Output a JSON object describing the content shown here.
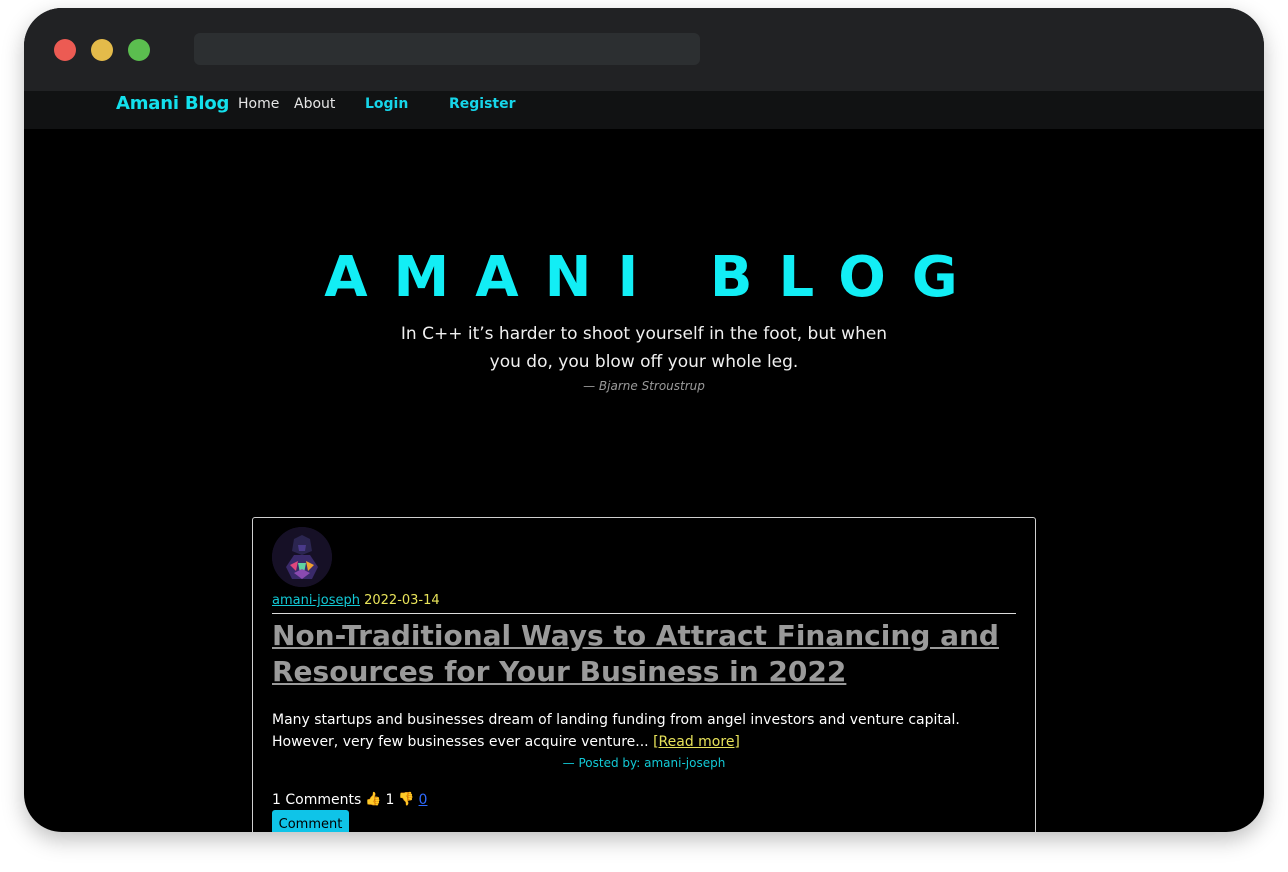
{
  "navbar": {
    "brand": "Amani Blog",
    "links": [
      "Home",
      "About",
      "Login",
      "Register"
    ]
  },
  "hero": {
    "title": "AMANI BLOG",
    "quote": "In C++ it’s harder to shoot yourself in the foot, but when you do, you blow off your whole leg.",
    "author": "— Bjarne Stroustrup"
  },
  "post": {
    "author": "amani-joseph",
    "date": "2022-03-14",
    "title": "Non-Traditional Ways to Attract Financing and Resources for Your Business in 2022",
    "excerpt": "Many startups and businesses dream of landing funding from angel investors and venture capital. However, very few businesses ever acquire venture...",
    "read_more": "[Read more]",
    "posted_by": "— Posted by: amani-joseph",
    "comments_label": "1 Comments",
    "likes": "1",
    "dislikes": "0",
    "comment_button": "Comment"
  },
  "colors": {
    "accent": "#12eef5",
    "date": "#e8e35a",
    "button": "#0fc4e8"
  }
}
